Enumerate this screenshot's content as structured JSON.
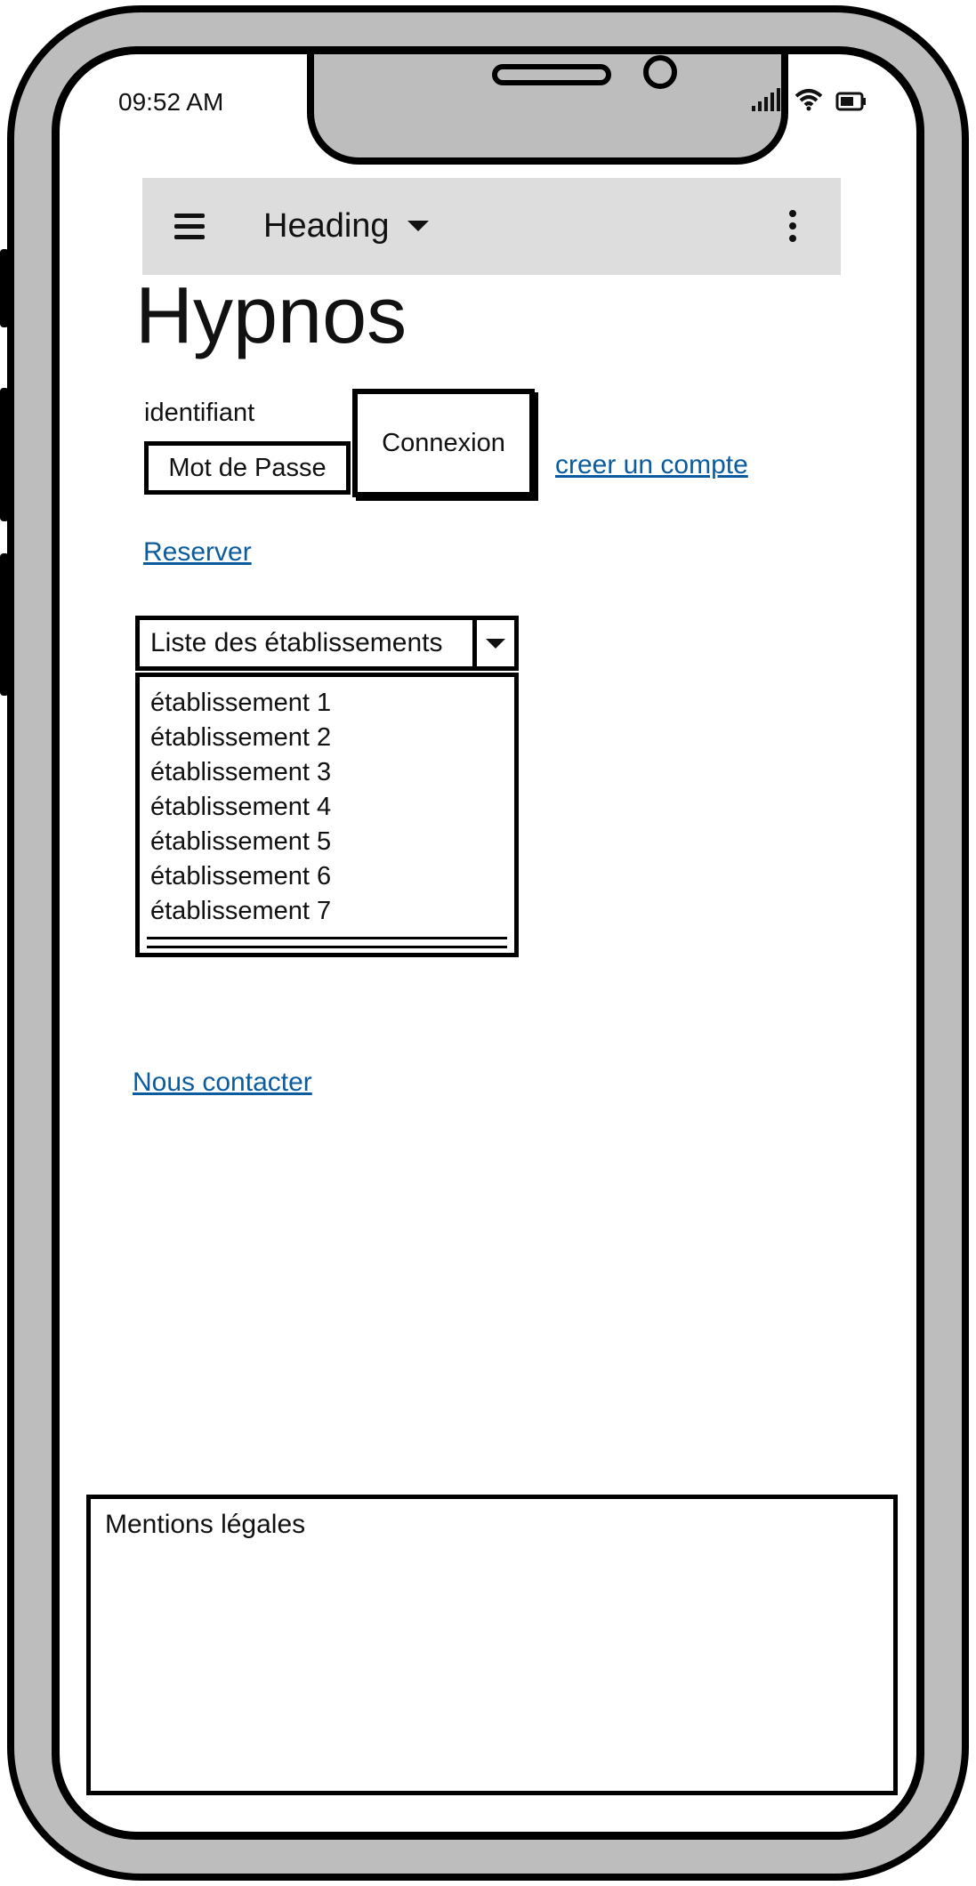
{
  "status_bar": {
    "time": "09:52 AM",
    "icons": [
      "signal-icon",
      "wifi-icon",
      "battery-icon"
    ]
  },
  "app_bar": {
    "title": "Heading",
    "icons": [
      "menu-icon",
      "chevron-down-icon",
      "more-vertical-icon"
    ]
  },
  "page": {
    "title": "Hypnos"
  },
  "login": {
    "identifier_label": "identifiant",
    "password_label": "Mot de Passe",
    "connect_button": "Connexion",
    "create_account_link": "creer un compte"
  },
  "reserve_link": "Reserver",
  "establishments": {
    "select_label": "Liste des établissements",
    "items": [
      "établissement 1",
      "établissement 2",
      "établissement 3",
      "établissement 4",
      "établissement 5",
      "établissement 6",
      "établissement 7"
    ]
  },
  "contact_link": "Nous contacter",
  "footer": {
    "legal": "Mentions légales"
  },
  "colors": {
    "link": "#0b5c9e",
    "frame": "#bdbdbd",
    "app_bar_bg": "#dddddd"
  }
}
